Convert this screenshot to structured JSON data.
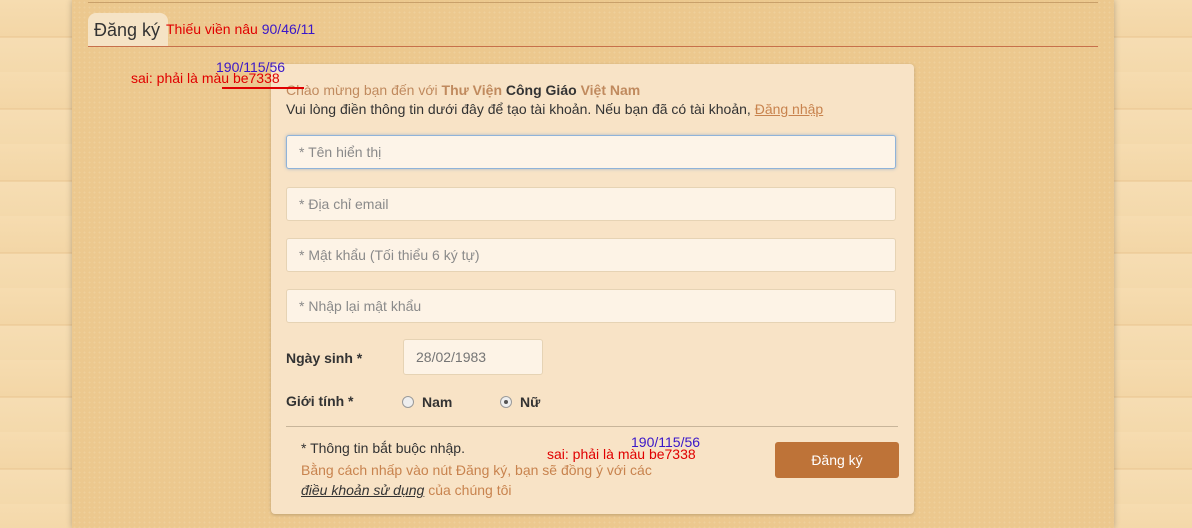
{
  "section": {
    "title": "Đăng ký"
  },
  "annotations": {
    "border_note": "Thiếu viền nâu",
    "border_rgb": "90/46/11",
    "rgb_top": "190/115/56",
    "wrong_color_top": "sai: phải là màu be7338",
    "rgb_bottom": "190/115/56",
    "wrong_color_bottom": "sai: phải là màu be7338"
  },
  "form": {
    "welcome_prefix": "Chào mừng bạn đến với",
    "welcome_b1": "Thư Viện",
    "welcome_b2": "Công Giáo",
    "welcome_b3": "Việt Nam",
    "intro_text": "Vui lòng điền thông tin dưới đây để tạo tài khoản. Nếu bạn đã có tài khoản,",
    "login_link": "Đăng nhập",
    "display_name_placeholder": "* Tên hiển thị",
    "email_placeholder": "* Địa chỉ email",
    "password_placeholder": "* Mật khẩu (Tối thiểu 6 ký tự)",
    "confirm_placeholder": "* Nhập lại mật khẩu",
    "birthday_label": "Ngày sinh *",
    "birthday_placeholder": "28/02/1983",
    "gender_label": "Giới tính *",
    "gender_male": "Nam",
    "gender_female": "Nữ",
    "gender_selected": "Nữ",
    "required_note": "* Thông tin bắt buộc nhập.",
    "terms_prefix": "Bằng cách nhấp vào nút Đăng ký, bạn sẽ đồng ý với các",
    "terms_link": "điều khoản sử dụng",
    "terms_suffix": "của chúng tôi",
    "submit_label": "Đăng ký"
  },
  "colors": {
    "button": "#be7338",
    "annotation_red": "#e00000",
    "annotation_blue": "#3a17c9"
  }
}
